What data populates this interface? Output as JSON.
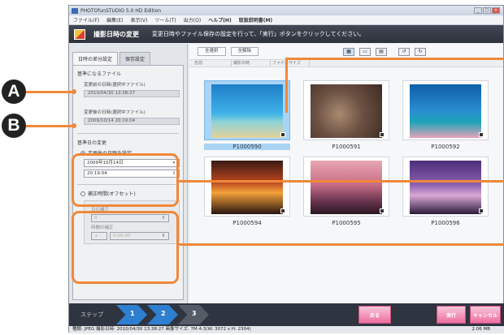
{
  "window": {
    "title": "PHOTOfunSTUDIO 5.0 HD Edition",
    "controls": [
      "_",
      "□",
      "×"
    ]
  },
  "menu": [
    "ファイル(F)",
    "編集(E)",
    "表示(V)",
    "ツール(T)",
    "出力(O)",
    "ヘルプ(H)",
    "取扱説明書(M)"
  ],
  "header": {
    "title": "撮影日時の変更",
    "description": "変更日時やファイル保存の設定を行って、「実行」ボタンをクリックしてください。"
  },
  "left": {
    "tabs": [
      "日時の差分設定",
      "保存設定"
    ],
    "base_file_title": "基準になるファイル",
    "before_label": "変更前の日時(選択中ファイル)",
    "before_value": "2010/04/30 13:38:27",
    "after_label": "変更後の日時(選択中ファイル)",
    "after_value": "2009/10/14 20:19:04",
    "base_date_title": "基準日の変更",
    "radio_after": "変更後の日時を設定",
    "date_value": "2009年10月14日",
    "time_value": "20:19:04",
    "radio_offset": "補正時間(オフセット)",
    "offset_day_label": "日の補正",
    "offset_time_label": "時間の補正",
    "offset_day_value": "0",
    "offset_sign": "+",
    "offset_time_value": "0:00:00"
  },
  "toolbar": {
    "select_all": "全選択",
    "deselect_all": "全解除"
  },
  "columns": [
    "名前",
    "撮影日時",
    "ファイルサイズ"
  ],
  "thumbnails": [
    {
      "label": "P1000590"
    },
    {
      "label": "P1000591"
    },
    {
      "label": "P1000592"
    },
    {
      "label": "P1000594"
    },
    {
      "label": "P1000595"
    },
    {
      "label": "P1000596"
    }
  ],
  "steps": {
    "label": "ステップ",
    "items": [
      "1",
      "2",
      "3"
    ]
  },
  "buttons": {
    "back": "戻る",
    "execute": "実行",
    "cancel": "キャンセル"
  },
  "status": {
    "info": "種類: JPEG 撮影日時: 2010/04/30 13:38:27 画像サイズ: 7M 4:3(W: 3072 x H: 2304)",
    "filesize": "2.06 MB"
  },
  "callouts": {
    "a": "A",
    "b": "B"
  },
  "colors": {
    "accent": "#f0883a",
    "step_active": "#2f7fd1",
    "button_pink": "#ec6e9e"
  }
}
